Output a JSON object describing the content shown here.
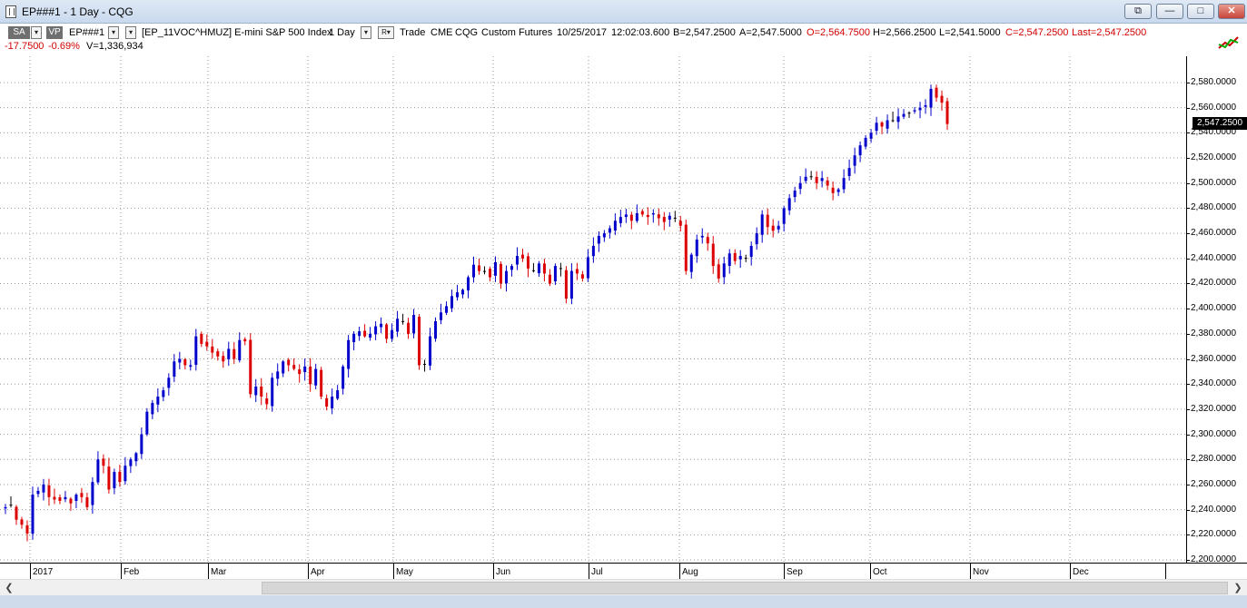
{
  "window": {
    "title": "EP###1 - 1 Day - CQG",
    "buttons": {
      "restore_all": "⧉",
      "minimize": "—",
      "maximize": "□",
      "close": "✕"
    }
  },
  "toolbar": {
    "sa_label": "SA",
    "vp_label": "VP",
    "symbol": "EP###1",
    "instrument": "[EP_11VOC^HMUZ] E-mini S&P 500 Index",
    "interval": "1 Day",
    "r_label": "R",
    "trade_label": "Trade",
    "exchange": "CME",
    "feed": "CQG",
    "futures_type": "Custom Futures",
    "date": "10/25/2017",
    "time": "12:02:03.600",
    "bid": "B=2,547.2500",
    "ask": "A=2,547.5000",
    "open": "O=2,564.7500",
    "high": "H=2,566.2500",
    "low": "L=2,541.5000",
    "close": "C=2,547.2500",
    "last": "Last=2,547.2500",
    "net_change": "-17.7500",
    "pct_change": "-0.69%",
    "volume": "V=1,336,934"
  },
  "colors": {
    "up": "#0000cc",
    "down": "#dd0000",
    "grid": "#999999",
    "neutral": "#000000"
  },
  "current_price_label": "2,547.2500",
  "chart_data": {
    "type": "candlestick",
    "y_range": [
      2200,
      2580
    ],
    "y_ticks": [
      "2,200.0000",
      "2,220.0000",
      "2,240.0000",
      "2,260.0000",
      "2,280.0000",
      "2,300.0000",
      "2,320.0000",
      "2,340.0000",
      "2,360.0000",
      "2,380.0000",
      "2,400.0000",
      "2,420.0000",
      "2,440.0000",
      "2,460.0000",
      "2,480.0000",
      "2,500.0000",
      "2,520.0000",
      "2,540.0000",
      "2,560.0000",
      "2,580.0000"
    ],
    "x_labels": [
      "2017",
      "Feb",
      "Mar",
      "Apr",
      "May",
      "Jun",
      "Jul",
      "Aug",
      "Sep",
      "Oct",
      "Nov",
      "Dec"
    ],
    "grid": true,
    "closes": [
      2242,
      2244,
      2232,
      2228,
      2221,
      2252,
      2255,
      2260,
      2250,
      2248,
      2247,
      2250,
      2245,
      2252,
      2250,
      2242,
      2262,
      2280,
      2275,
      2256,
      2270,
      2262,
      2275,
      2280,
      2285,
      2300,
      2318,
      2325,
      2330,
      2335,
      2345,
      2358,
      2360,
      2355,
      2355,
      2378,
      2372,
      2370,
      2365,
      2362,
      2358,
      2368,
      2360,
      2375,
      2374,
      2332,
      2338,
      2330,
      2324,
      2345,
      2350,
      2358,
      2355,
      2352,
      2348,
      2354,
      2340,
      2352,
      2330,
      2322,
      2330,
      2335,
      2354,
      2375,
      2380,
      2382,
      2378,
      2380,
      2386,
      2388,
      2376,
      2383,
      2392,
      2390,
      2380,
      2395,
      2355,
      2356,
      2378,
      2390,
      2397,
      2402,
      2410,
      2413,
      2415,
      2425,
      2435,
      2430,
      2430,
      2425,
      2437,
      2420,
      2430,
      2434,
      2442,
      2440,
      2432,
      2430,
      2436,
      2428,
      2420,
      2434,
      2432,
      2408,
      2430,
      2428,
      2424,
      2441,
      2450,
      2458,
      2460,
      2464,
      2470,
      2473,
      2475,
      2470,
      2476,
      2475,
      2473,
      2476,
      2472,
      2469,
      2474,
      2472,
      2466,
      2430,
      2443,
      2455,
      2458,
      2452,
      2434,
      2424,
      2436,
      2444,
      2438,
      2442,
      2440,
      2450,
      2460,
      2475,
      2465,
      2462,
      2466,
      2480,
      2488,
      2494,
      2500,
      2505,
      2505,
      2500,
      2504,
      2498,
      2492,
      2495,
      2504,
      2512,
      2522,
      2530,
      2536,
      2540,
      2548,
      2545,
      2550,
      2550,
      2553,
      2555,
      2556,
      2558,
      2560,
      2562,
      2575,
      2568,
      2564,
      2547
    ]
  }
}
